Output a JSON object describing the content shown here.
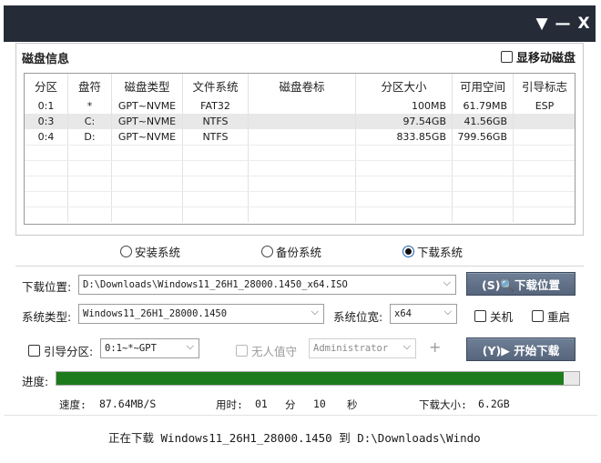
{
  "window": {
    "buttons": {
      "menu": "▼",
      "minimize": "—",
      "close": "X"
    }
  },
  "disk_info": {
    "title": "磁盘信息",
    "show_mobile_label": "显移动磁盘",
    "columns": [
      "分区",
      "盘符",
      "磁盘类型",
      "文件系统",
      "磁盘卷标",
      "分区大小",
      "可用空间",
      "引导标志"
    ],
    "rows": [
      {
        "partition": "0:1",
        "drive": "*",
        "disk_type": "GPT~NVME",
        "fs": "FAT32",
        "label": "",
        "size": "100MB",
        "free": "61.79MB",
        "boot": "ESP"
      },
      {
        "partition": "0:3",
        "drive": "C:",
        "disk_type": "GPT~NVME",
        "fs": "NTFS",
        "label": "",
        "size": "97.54GB",
        "free": "41.56GB",
        "boot": ""
      },
      {
        "partition": "0:4",
        "drive": "D:",
        "disk_type": "GPT~NVME",
        "fs": "NTFS",
        "label": "",
        "size": "833.85GB",
        "free": "799.56GB",
        "boot": ""
      }
    ]
  },
  "modes": {
    "install": "安装系统",
    "backup": "备份系统",
    "download": "下载系统",
    "selected": "download"
  },
  "download": {
    "location_label": "下载位置:",
    "location_value": "D:\\Downloads\\Windows11_26H1_28000.1450_x64.ISO",
    "location_button": "(S)🔍下载位置",
    "system_type_label": "系统类型:",
    "system_type_value": "Windows11_26H1_28000.1450",
    "arch_label": "系统位宽:",
    "arch_value": "x64",
    "shutdown_label": "关机",
    "restart_label": "重启",
    "boot_partition_label": "引导分区:",
    "boot_partition_value": "0:1~*~GPT",
    "unattended_label": "无人值守",
    "user_value": "Administrator",
    "plus": "+",
    "start_button": "(Y)▶ 开始下载"
  },
  "progress": {
    "label": "进度:",
    "percent": 97
  },
  "stats": {
    "speed_label": "速度:",
    "speed_value": "87.64MB/S",
    "elapsed_label": "用时:",
    "elapsed_min": "01",
    "min_unit": "分",
    "elapsed_sec": "10",
    "sec_unit": "秒",
    "size_label": "下载大小:",
    "size_value": "6.2GB"
  },
  "status_text": "正在下载 Windows11_26H1_28000.1450 到 D:\\Downloads\\Windo",
  "colors": {
    "titlebar": "#252c38",
    "progress": "#1d7a1d",
    "button": "#5e6d83"
  }
}
